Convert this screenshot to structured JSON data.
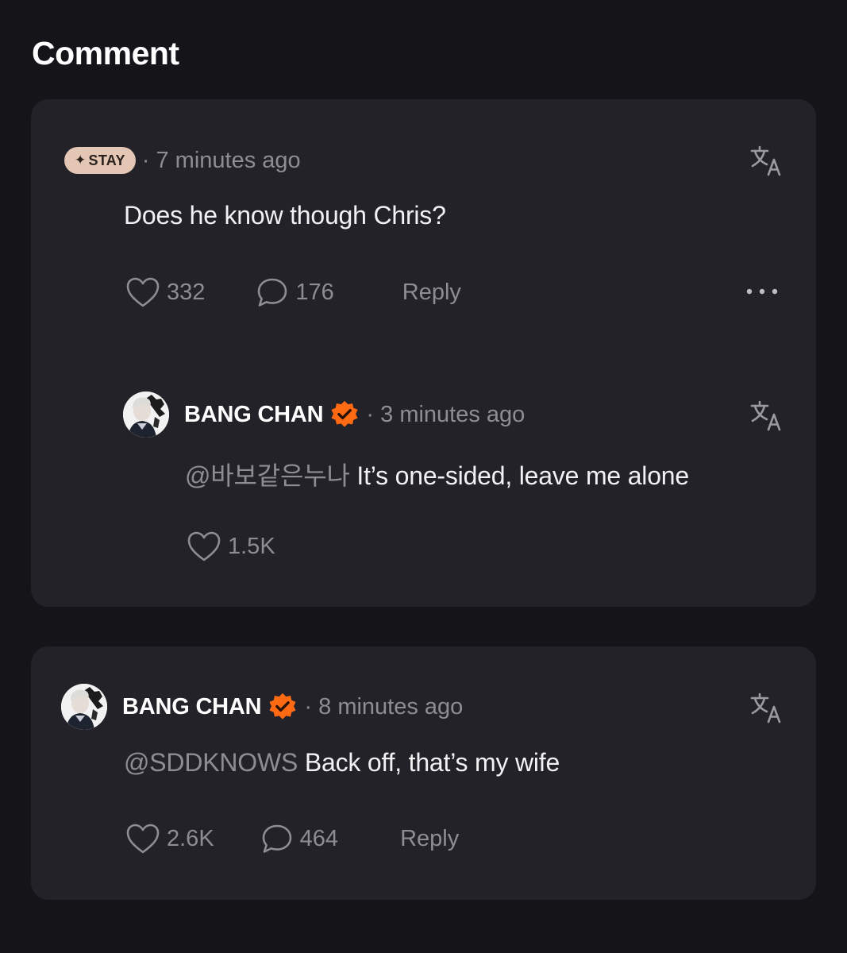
{
  "page_title": "Comment",
  "colors": {
    "accent_badge": "#e3c6b3",
    "verified_orange": "#ff6a13",
    "muted_text": "#8d8d95",
    "card_bg": "#222228",
    "page_bg": "#141419"
  },
  "comments": [
    {
      "author": "",
      "badge": "STAY",
      "time": "· 7 minutes ago",
      "text": "Does he know though Chris?",
      "likes": "332",
      "replies": "176",
      "reply_label": "Reply",
      "translate_icon": "translate-icon",
      "more_icon": "more-dots-icon",
      "thread": [
        {
          "author": "BANG CHAN",
          "verified_icon": "verified-badge-icon",
          "time": "· 3 minutes ago",
          "mention": "@바보같은누나",
          "text": " It’s one-sided, leave me alone",
          "likes": "1.5K",
          "translate_icon": "translate-icon"
        }
      ]
    },
    {
      "author": "BANG CHAN",
      "verified_icon": "verified-badge-icon",
      "time": "· 8 minutes ago",
      "mention": "@SDDKNOWS",
      "text": " Back off, that’s my wife",
      "likes": "2.6K",
      "replies": "464",
      "reply_label": "Reply",
      "translate_icon": "translate-icon"
    }
  ]
}
